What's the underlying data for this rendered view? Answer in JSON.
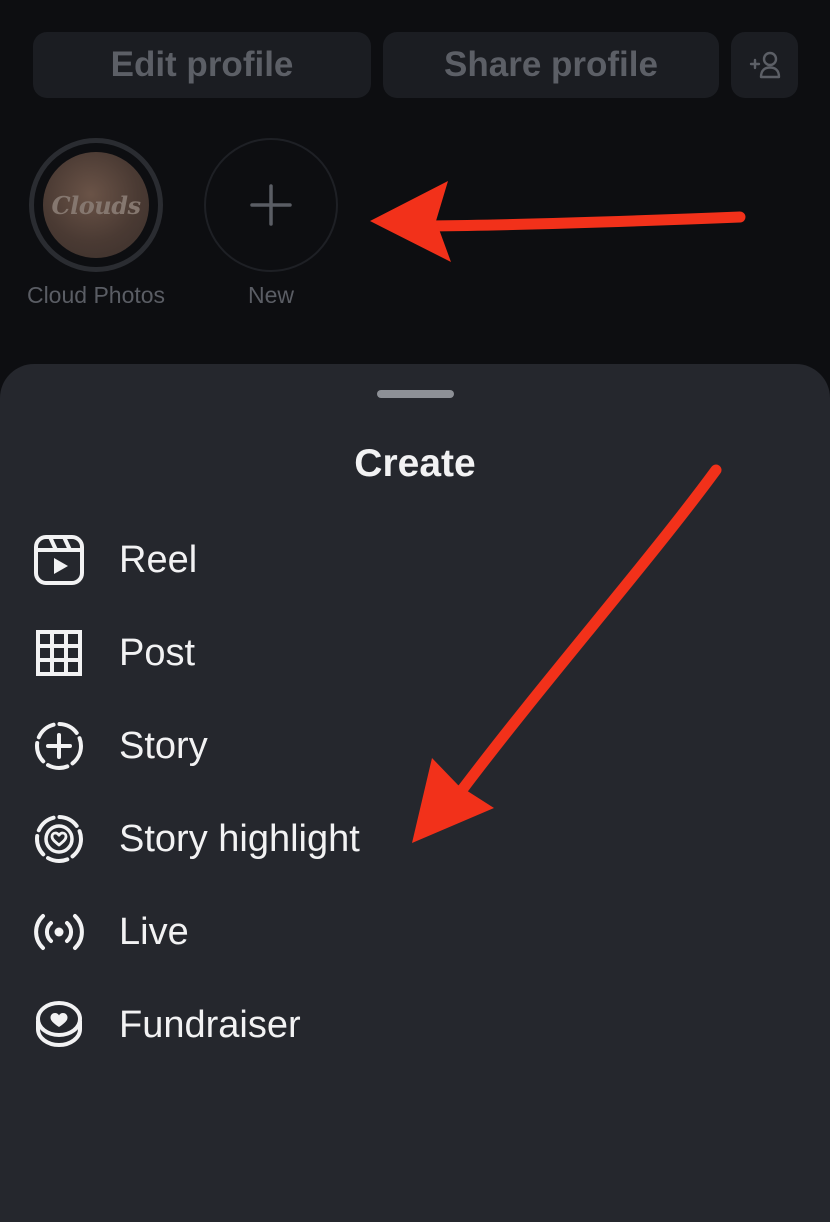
{
  "profile": {
    "edit_label": "Edit profile",
    "share_label": "Share profile",
    "add_user_icon": "add-user-icon"
  },
  "highlights": [
    {
      "thumb_text": "Clouds",
      "label": "Cloud Photos"
    },
    {
      "label": "New",
      "icon": "plus-icon"
    }
  ],
  "sheet": {
    "title": "Create",
    "items": [
      {
        "label": "Reel",
        "icon": "reel-icon"
      },
      {
        "label": "Post",
        "icon": "grid-icon"
      },
      {
        "label": "Story",
        "icon": "story-add-icon"
      },
      {
        "label": "Story highlight",
        "icon": "story-highlight-icon"
      },
      {
        "label": "Live",
        "icon": "live-broadcast-icon"
      },
      {
        "label": "Fundraiser",
        "icon": "fundraiser-icon"
      }
    ]
  },
  "colors": {
    "background": "#0c0d10",
    "sheet": "#25272d",
    "text": "#f2f2f3",
    "annotation_arrow": "#f2311a"
  }
}
